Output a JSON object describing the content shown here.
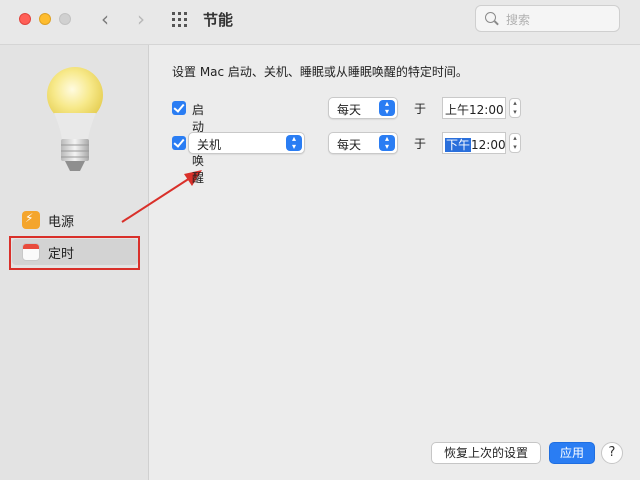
{
  "window": {
    "title": "节能",
    "search_placeholder": "搜索"
  },
  "toolbar": {
    "back_icon": "‹",
    "forward_icon": "›"
  },
  "sidebar": {
    "items": [
      {
        "label": "电源",
        "icon": "power-icon"
      },
      {
        "label": "定时",
        "icon": "calendar-icon",
        "selected": true
      }
    ]
  },
  "schedule": {
    "description": "设置 Mac 启动、关机、睡眠或从睡眠唤醒的特定时间。",
    "rows": [
      {
        "checked": true,
        "action": "启动或唤醒",
        "frequency": "每天",
        "at_label": "于",
        "time": "上午12:00",
        "time_selected_part": "",
        "time_rest": "上午12:00"
      },
      {
        "checked": true,
        "action": "关机",
        "frequency": "每天",
        "at_label": "于",
        "time_selected_part": "下午",
        "time_rest": "12:00"
      }
    ]
  },
  "buttons": {
    "restore": "恢复上次的设置",
    "apply": "应用",
    "help": "?"
  },
  "colors": {
    "accent": "#2a7df3",
    "annotation_red": "#d9302a"
  }
}
